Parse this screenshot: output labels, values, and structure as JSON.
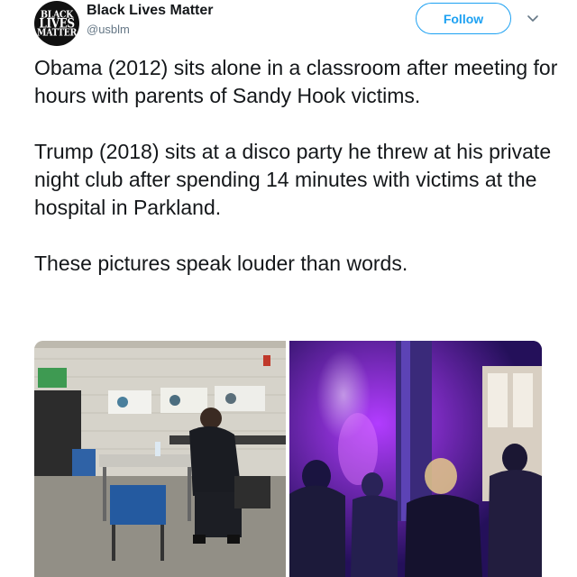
{
  "tweet": {
    "avatar_text": [
      "BLACK",
      "LIVES",
      "MATTER"
    ],
    "display_name": "Black Lives Matter",
    "handle": "@usblm",
    "follow_label": "Follow",
    "caret_icon": "chevron-down-icon",
    "text": "Obama (2012) sits alone in a classroom after meeting for hours with parents of Sandy Hook victims.\n\nTrump (2018) sits at a disco party he threw at his private night club after spending 14 minutes with victims at the hospital in Parkland.\n\nThese pictures speak louder than words."
  },
  "colors": {
    "accent": "#1da1f2",
    "text": "#14171a",
    "secondary_text": "#657786"
  }
}
